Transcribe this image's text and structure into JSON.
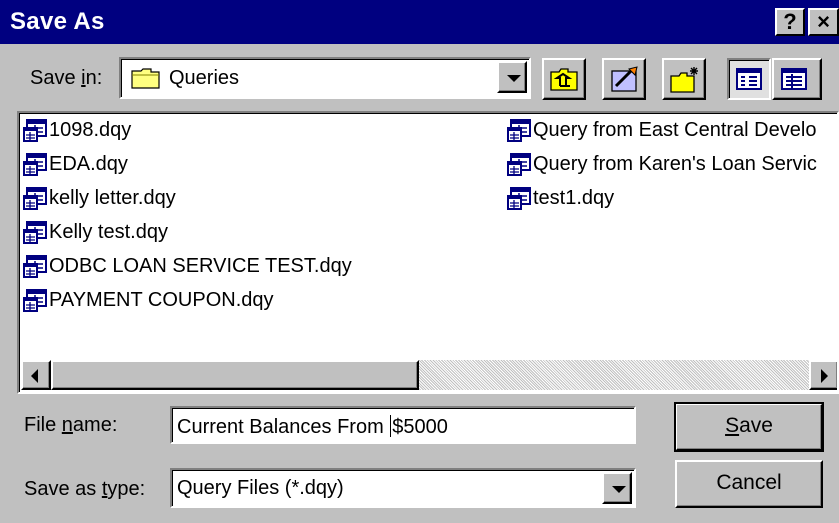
{
  "dialog": {
    "title": "Save As",
    "help_label": "?",
    "close_label": "×"
  },
  "save_in": {
    "label_pre": "Save ",
    "label_accel": "i",
    "label_post": "n:",
    "value": "Queries"
  },
  "toolbar": {
    "icons": [
      "up-one-level-icon",
      "look-in-favorites-icon",
      "create-new-folder-icon",
      "list-view-icon",
      "details-view-icon"
    ]
  },
  "files": {
    "column1": [
      "1098.dqy",
      "EDA.dqy",
      "kelly letter.dqy",
      "Kelly test.dqy",
      "ODBC LOAN SERVICE TEST.dqy",
      "PAYMENT COUPON.dqy"
    ],
    "column2": [
      "Query from East Central Develo",
      "Query from Karen's Loan Servic",
      "test1.dqy"
    ]
  },
  "file_name": {
    "label_pre": "File ",
    "label_accel": "n",
    "label_post": "ame:",
    "value_before_caret": "Current Balances From ",
    "value_after_caret": "$5000"
  },
  "save_as_type": {
    "label_pre": "Save as ",
    "label_accel": "t",
    "label_post": "ype:",
    "value": "Query Files (*.dqy)"
  },
  "buttons": {
    "save_accel": "S",
    "save_rest": "ave",
    "cancel": "Cancel"
  },
  "colors": {
    "titlebar": "#000080",
    "face": "#c0c0c0",
    "icon_blue": "#000080",
    "folder_yellow": "#ffff00"
  }
}
